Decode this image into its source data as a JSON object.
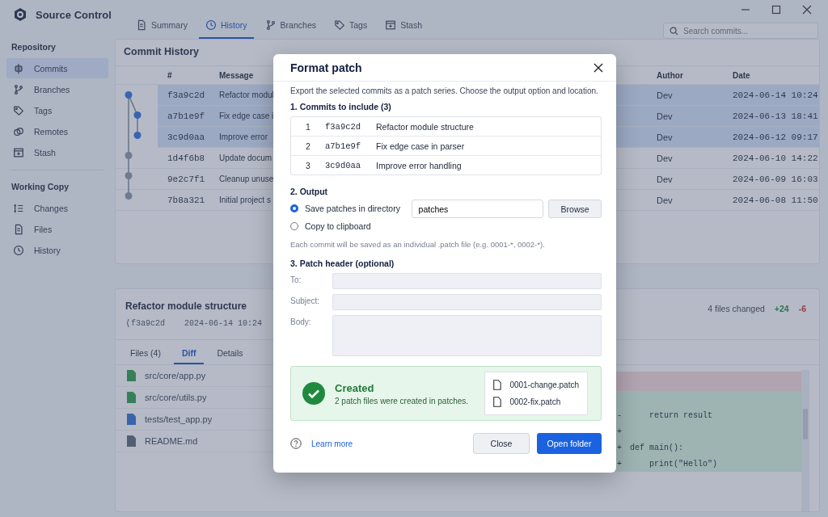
{
  "app": {
    "title": "Source Control"
  },
  "tabs": [
    {
      "label": "Summary",
      "selected": false
    },
    {
      "label": "History",
      "selected": true
    },
    {
      "label": "Branches",
      "selected": false
    },
    {
      "label": "Tags",
      "selected": false
    },
    {
      "label": "Stash",
      "selected": false
    }
  ],
  "search": {
    "placeholder": "Search commits..."
  },
  "sidebar": {
    "sections": [
      {
        "heading": "Repository",
        "items": [
          {
            "label": "Commits",
            "selected": true
          },
          {
            "label": "Branches",
            "selected": false
          },
          {
            "label": "Tags",
            "selected": false
          },
          {
            "label": "Remotes",
            "selected": false
          },
          {
            "label": "Stash",
            "selected": false
          }
        ]
      },
      {
        "heading": "Working Copy",
        "items": [
          {
            "label": "Changes",
            "selected": false
          },
          {
            "label": "Files",
            "selected": false
          },
          {
            "label": "History",
            "selected": false
          }
        ]
      }
    ]
  },
  "commit_history": {
    "title": "Commit History",
    "columns": [
      "#",
      "Message",
      "Author",
      "Date"
    ],
    "rows": [
      {
        "hash": "f3a9c2d",
        "message": "Refactor modul",
        "author": "Dev",
        "date": "2024-06-14 10:24",
        "selected": true
      },
      {
        "hash": "a7b1e9f",
        "message": "Fix edge case i",
        "author": "Dev",
        "date": "2024-06-13 18:41",
        "selected": true
      },
      {
        "hash": "3c9d0aa",
        "message": "Improve error",
        "author": "Dev",
        "date": "2024-06-12 09:17",
        "selected": true
      },
      {
        "hash": "1d4f6b8",
        "message": "Update docum",
        "author": "Dev",
        "date": "2024-06-10 14:22",
        "selected": false
      },
      {
        "hash": "9e2c7f1",
        "message": "Cleanup unuse",
        "author": "Dev",
        "date": "2024-06-09 16:03",
        "selected": false
      },
      {
        "hash": "7b8a321",
        "message": "Initial project s",
        "author": "Dev",
        "date": "2024-06-08 11:50",
        "selected": false
      }
    ]
  },
  "commit_detail": {
    "title": "Refactor module structure",
    "hash": "f3a9c2d",
    "date": "2024-06-14 10:24",
    "summary": "4 files changed",
    "additions": "+24",
    "deletions": "-6",
    "tabs": [
      {
        "label": "Files (4)",
        "selected": false
      },
      {
        "label": "Diff",
        "selected": true
      },
      {
        "label": "Details",
        "selected": false
      }
    ],
    "files": [
      {
        "name": "src/core/app.py",
        "kind": "source"
      },
      {
        "name": "src/core/utils.py",
        "kind": "source"
      },
      {
        "name": "tests/test_app.py",
        "kind": "test"
      },
      {
        "name": "README.md",
        "kind": "doc"
      }
    ],
    "diff_lines": [
      {
        "kind": "removed"
      },
      {
        "kind": "added"
      },
      {
        "kind": "added",
        "sign": "-",
        "code": "    return result"
      },
      {
        "kind": "added",
        "sign": "+"
      },
      {
        "kind": "added",
        "sign": "+",
        "code": "def main():"
      },
      {
        "kind": "added",
        "sign": "+",
        "code": "    print(\"Hello\")"
      }
    ]
  },
  "dialog": {
    "title": "Format patch",
    "description": "Export the selected commits as a patch series. Choose the output option and location.",
    "commits_heading": "1. Commits to include (3)",
    "commits": [
      {
        "index": "1",
        "hash": "f3a9c2d",
        "message": "Refactor module structure"
      },
      {
        "index": "2",
        "hash": "a7b1e9f",
        "message": "Fix edge case in parser"
      },
      {
        "index": "3",
        "hash": "3c9d0aa",
        "message": "Improve error handling"
      }
    ],
    "output_heading": "2. Output",
    "output_options": [
      {
        "label": "Save patches in directory",
        "selected": true
      },
      {
        "label": "Copy to clipboard",
        "selected": false
      }
    ],
    "directory": {
      "value": "patches"
    },
    "browse_button": "Browse",
    "output_hint": "Each commit will be saved as an individual .patch file (e.g. 0001-*, 0002-*).",
    "header_heading": "3. Patch header (optional)",
    "header_fields": [
      {
        "label": "To:",
        "kind": "line"
      },
      {
        "label": "Subject:",
        "kind": "line"
      },
      {
        "label": "Body:",
        "kind": "area"
      }
    ],
    "result": {
      "title": "Created",
      "message": "2 patch files were created in patches.",
      "files": [
        "0001-change.patch",
        "0002-fix.patch"
      ]
    },
    "learn_more": "Learn more",
    "buttons": [
      {
        "label": "Close",
        "kind": "secondary"
      },
      {
        "label": "Open folder",
        "kind": "primary"
      }
    ]
  }
}
